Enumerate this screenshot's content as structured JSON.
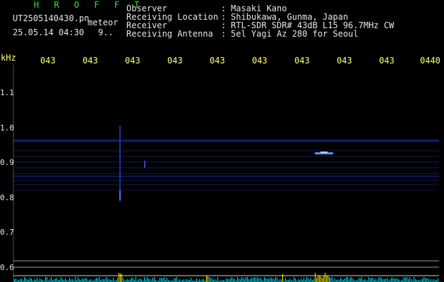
{
  "header": {
    "brand": "H R O F F T",
    "filename": "UT2505140430.pn",
    "mode": "meteor",
    "datetime": "25.05.14 04:30",
    "count": "9..",
    "fields": [
      {
        "label": "Observer",
        "sep": ":",
        "value": "Masaki Kano"
      },
      {
        "label": "Receiving Location",
        "sep": ":",
        "value": "Shibukawa, Gunma, Japan"
      },
      {
        "label": "Receiver",
        "sep": ":",
        "value": "RTL-SDR SDR# 43dB L15 96.7MHz CW"
      },
      {
        "label": "Receiving Antenna",
        "sep": ":",
        "value": "5el Yagi Az 280 for Seoul"
      }
    ]
  },
  "axes": {
    "y_unit": "kHz",
    "x_ticks": [
      "043",
      "043",
      "043",
      "043",
      "043",
      "043",
      "043",
      "043",
      "043",
      "0440"
    ],
    "y_ticks": [
      "1.1",
      "1.0",
      "0.9",
      "0.8",
      "0.7",
      "0.6"
    ]
  },
  "colors": {
    "waterfall_line": "#1e3cc8",
    "axis_text": "#e6e6e6",
    "label_text": "#ffff80",
    "brand": "#32e632",
    "spectrum_cyan": "#00e6ff",
    "spectrum_yellow": "#ffff00"
  }
}
